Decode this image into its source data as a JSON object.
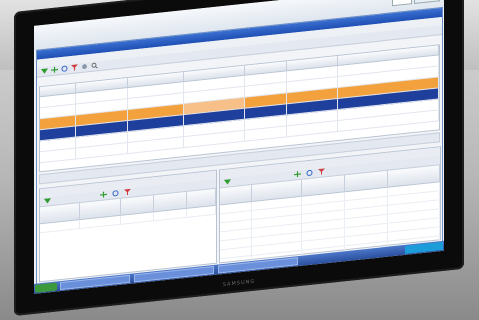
{
  "monitor": {
    "brand": "SAMSUNG"
  },
  "top_strip": {
    "page_label": "",
    "page_value": "",
    "button_label": ""
  },
  "window": {
    "title": "",
    "menu": [
      "",
      ""
    ],
    "toolbar_icons": [
      "green-arrow-icon",
      "add-icon",
      "refresh-icon",
      "filter-icon",
      "settings-icon",
      "search-icon"
    ]
  },
  "orders_table": {
    "columns": [
      "",
      "",
      "",
      "",
      "",
      "",
      ""
    ],
    "rows": [
      {
        "state": "normal",
        "cells": [
          "",
          "",
          "",
          "",
          "",
          "",
          ""
        ]
      },
      {
        "state": "normal",
        "cells": [
          "",
          "",
          "",
          "",
          "",
          "",
          ""
        ]
      },
      {
        "state": "orange",
        "cells": [
          "",
          "",
          "",
          "",
          "",
          "",
          ""
        ]
      },
      {
        "state": "selected",
        "cells": [
          "",
          "",
          "",
          "",
          "",
          "",
          ""
        ]
      },
      {
        "state": "normal",
        "cells": [
          "",
          "",
          "",
          "",
          "",
          "",
          ""
        ]
      },
      {
        "state": "normal",
        "cells": [
          "",
          "",
          "",
          "",
          "",
          "",
          ""
        ]
      }
    ]
  },
  "left_panel": {
    "tabs": [
      "",
      ""
    ],
    "columns": [
      "",
      "",
      "",
      "",
      ""
    ],
    "rows": [
      [
        "",
        "",
        "",
        "",
        ""
      ]
    ]
  },
  "right_panel": {
    "tabs": [
      "",
      ""
    ],
    "columns": [
      "",
      "",
      "",
      "",
      ""
    ],
    "rows": [
      [
        "",
        "",
        "",
        "",
        ""
      ],
      [
        "",
        "",
        "",
        "",
        ""
      ],
      [
        "",
        "",
        "",
        "",
        ""
      ],
      [
        "",
        "",
        "",
        "",
        ""
      ],
      [
        "",
        "",
        "",
        "",
        ""
      ],
      [
        "",
        "",
        "",
        "",
        ""
      ],
      [
        "",
        "",
        "",
        "",
        ""
      ]
    ]
  },
  "taskbar": {
    "start_label": "",
    "tasks": [
      "",
      "",
      ""
    ],
    "clock": ""
  },
  "colors": {
    "title_blue": "#1f4fb4",
    "row_orange": "#f2a13d",
    "row_selected": "#1f3f9c",
    "taskbar": "#2a4f9e"
  }
}
